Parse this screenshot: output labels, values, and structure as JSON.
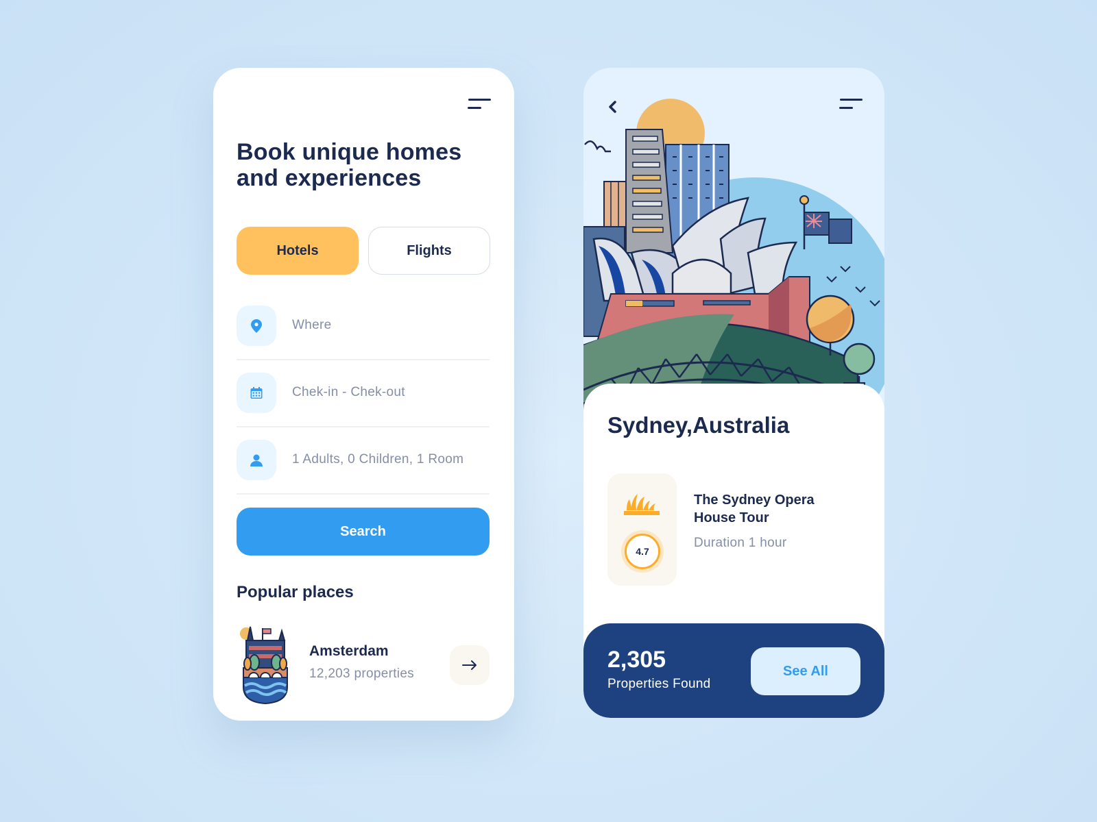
{
  "left_screen": {
    "headline": "Book unique homes and experiences",
    "tabs": [
      {
        "label": "Hotels",
        "active": true
      },
      {
        "label": "Flights",
        "active": false
      }
    ],
    "fields": {
      "where": {
        "icon": "location-pin-icon",
        "placeholder": "Where"
      },
      "dates": {
        "icon": "calendar-icon",
        "placeholder": "Chek-in  -  Chek-out"
      },
      "guests": {
        "icon": "person-icon",
        "value": "1 Adults, 0 Children, 1 Room"
      }
    },
    "search_label": "Search",
    "popular_title": "Popular places",
    "popular_places": [
      {
        "name": "Amsterdam",
        "properties": "12,203 properties",
        "illustration": "amsterdam-illustration"
      }
    ]
  },
  "right_screen": {
    "city": "Sydney,Australia",
    "tour": {
      "title": "The Sydney Opera House Tour",
      "duration": "Duration 1 hour",
      "rating": "4.7",
      "icon": "opera-house-icon"
    },
    "results": {
      "count": "2,305",
      "label": "Properties Found",
      "button": "See All"
    }
  },
  "colors": {
    "primary_blue": "#319cf0",
    "accent_yellow": "#fec15e",
    "navy": "#1b2a4e",
    "results_bar": "#1e4280",
    "muted_text": "#858ea6"
  }
}
